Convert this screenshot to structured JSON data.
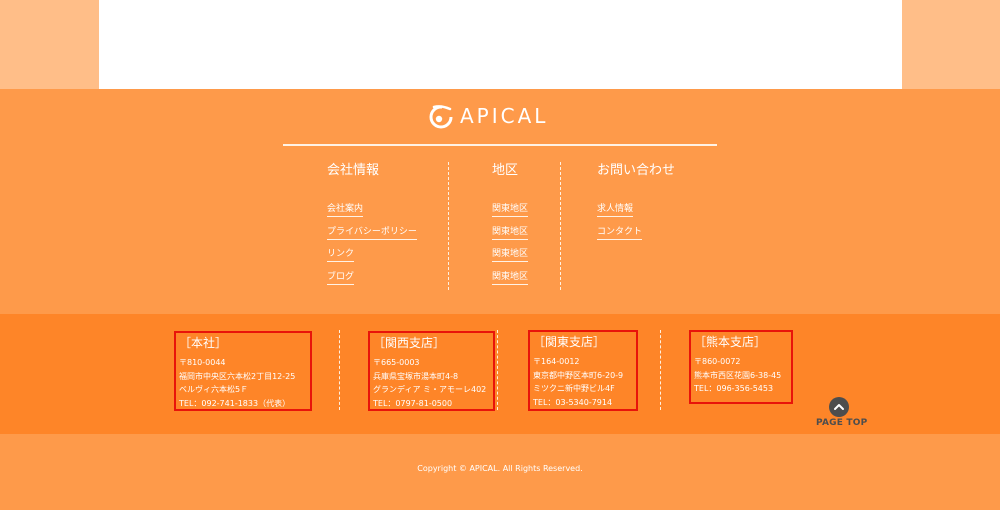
{
  "brand": {
    "name": "APICAL",
    "logo_icon": "apical-swirl-icon"
  },
  "nav": [
    {
      "heading": "会社情報",
      "links": [
        "会社案内",
        "プライバシーポリシー",
        "リンク",
        "ブログ"
      ]
    },
    {
      "heading": "地区",
      "links": [
        "関東地区",
        "関東地区",
        "関東地区",
        "関東地区"
      ]
    },
    {
      "heading": "お問い合わせ",
      "links": [
        "求人情報",
        "コンタクト"
      ]
    }
  ],
  "offices": [
    {
      "title": "［本社］",
      "lines": [
        "〒810-0044",
        "福岡市中央区六本松2丁目12-25",
        "ベルヴィ六本松5Ｆ",
        "TEL：092-741-1833（代表）"
      ]
    },
    {
      "title": "［関西支店］",
      "lines": [
        "〒665-0003",
        "兵庫県宝塚市湯本町4-8",
        "グランディア ミ・アモーレ402",
        "TEL：0797-81-0500"
      ]
    },
    {
      "title": "［関東支店］",
      "lines": [
        "〒164-0012",
        "東京都中野区本町6-20-9",
        "ミツクニ新中野ビル4F",
        "TEL：03-5340-7914"
      ]
    },
    {
      "title": "［熊本支店］",
      "lines": [
        "〒860-0072",
        "熊本市西区花園6-38-45",
        "TEL：096-356-5453"
      ]
    }
  ],
  "page_top": {
    "label": "PAGE TOP",
    "icon": "chevron-up-icon"
  },
  "copyright": "Copyright © APICAL. All Rights Reserved.",
  "colors": {
    "top_band": "#ffbe88",
    "nav_band": "#fe9a4a",
    "office_band": "#fe8528",
    "highlight_box": "#e8140a",
    "page_top": "#4d4d4d"
  }
}
